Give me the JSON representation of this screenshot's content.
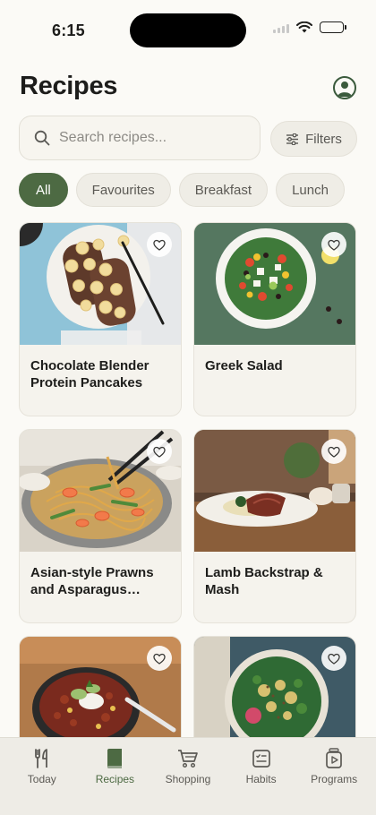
{
  "status_bar": {
    "time": "6:15"
  },
  "header": {
    "title": "Recipes"
  },
  "search": {
    "placeholder": "Search recipes..."
  },
  "filters": {
    "label": "Filters"
  },
  "categories": [
    {
      "label": "All",
      "active": true
    },
    {
      "label": "Favourites",
      "active": false
    },
    {
      "label": "Breakfast",
      "active": false
    },
    {
      "label": "Lunch",
      "active": false
    }
  ],
  "recipes": [
    {
      "title": "Chocolate Blender Protein Pancakes",
      "favourite": false
    },
    {
      "title": "Greek Salad",
      "favourite": false
    },
    {
      "title": "Asian-style Prawns and Asparagus Noodles",
      "favourite": false
    },
    {
      "title": "Lamb Backstrap & Mash",
      "favourite": false
    },
    {
      "title": "",
      "favourite": false
    },
    {
      "title": "",
      "favourite": false
    }
  ],
  "tabs": [
    {
      "label": "Today",
      "icon": "fork-knife-icon",
      "active": false
    },
    {
      "label": "Recipes",
      "icon": "book-icon",
      "active": true
    },
    {
      "label": "Shopping",
      "icon": "cart-icon",
      "active": false
    },
    {
      "label": "Habits",
      "icon": "checklist-icon",
      "active": false
    },
    {
      "label": "Programs",
      "icon": "play-box-icon",
      "active": false
    }
  ],
  "colors": {
    "accent": "#4d6a43",
    "background": "#fbfaf6",
    "card": "#f5f3ed",
    "tabbar": "#eeece6"
  }
}
